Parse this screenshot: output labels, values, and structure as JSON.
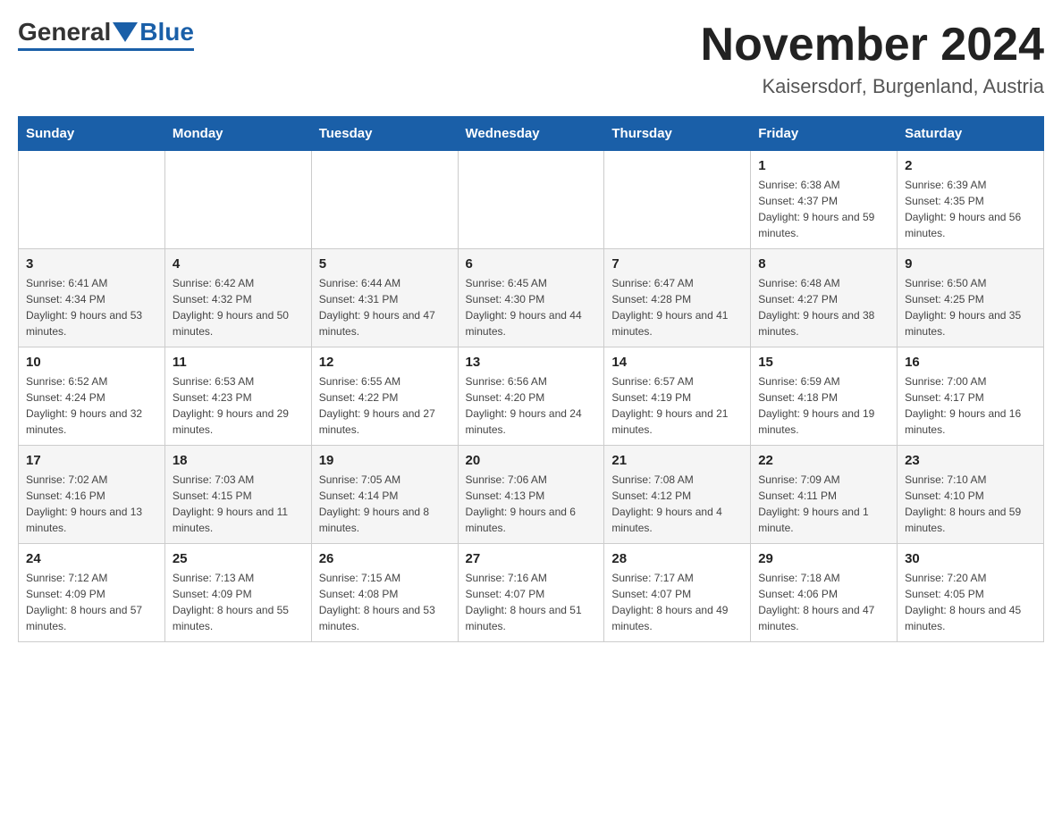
{
  "header": {
    "logo_general": "General",
    "logo_blue": "Blue",
    "month_title": "November 2024",
    "location": "Kaisersdorf, Burgenland, Austria"
  },
  "weekdays": [
    "Sunday",
    "Monday",
    "Tuesday",
    "Wednesday",
    "Thursday",
    "Friday",
    "Saturday"
  ],
  "weeks": [
    [
      {
        "day": "",
        "info": ""
      },
      {
        "day": "",
        "info": ""
      },
      {
        "day": "",
        "info": ""
      },
      {
        "day": "",
        "info": ""
      },
      {
        "day": "",
        "info": ""
      },
      {
        "day": "1",
        "info": "Sunrise: 6:38 AM\nSunset: 4:37 PM\nDaylight: 9 hours and 59 minutes."
      },
      {
        "day": "2",
        "info": "Sunrise: 6:39 AM\nSunset: 4:35 PM\nDaylight: 9 hours and 56 minutes."
      }
    ],
    [
      {
        "day": "3",
        "info": "Sunrise: 6:41 AM\nSunset: 4:34 PM\nDaylight: 9 hours and 53 minutes."
      },
      {
        "day": "4",
        "info": "Sunrise: 6:42 AM\nSunset: 4:32 PM\nDaylight: 9 hours and 50 minutes."
      },
      {
        "day": "5",
        "info": "Sunrise: 6:44 AM\nSunset: 4:31 PM\nDaylight: 9 hours and 47 minutes."
      },
      {
        "day": "6",
        "info": "Sunrise: 6:45 AM\nSunset: 4:30 PM\nDaylight: 9 hours and 44 minutes."
      },
      {
        "day": "7",
        "info": "Sunrise: 6:47 AM\nSunset: 4:28 PM\nDaylight: 9 hours and 41 minutes."
      },
      {
        "day": "8",
        "info": "Sunrise: 6:48 AM\nSunset: 4:27 PM\nDaylight: 9 hours and 38 minutes."
      },
      {
        "day": "9",
        "info": "Sunrise: 6:50 AM\nSunset: 4:25 PM\nDaylight: 9 hours and 35 minutes."
      }
    ],
    [
      {
        "day": "10",
        "info": "Sunrise: 6:52 AM\nSunset: 4:24 PM\nDaylight: 9 hours and 32 minutes."
      },
      {
        "day": "11",
        "info": "Sunrise: 6:53 AM\nSunset: 4:23 PM\nDaylight: 9 hours and 29 minutes."
      },
      {
        "day": "12",
        "info": "Sunrise: 6:55 AM\nSunset: 4:22 PM\nDaylight: 9 hours and 27 minutes."
      },
      {
        "day": "13",
        "info": "Sunrise: 6:56 AM\nSunset: 4:20 PM\nDaylight: 9 hours and 24 minutes."
      },
      {
        "day": "14",
        "info": "Sunrise: 6:57 AM\nSunset: 4:19 PM\nDaylight: 9 hours and 21 minutes."
      },
      {
        "day": "15",
        "info": "Sunrise: 6:59 AM\nSunset: 4:18 PM\nDaylight: 9 hours and 19 minutes."
      },
      {
        "day": "16",
        "info": "Sunrise: 7:00 AM\nSunset: 4:17 PM\nDaylight: 9 hours and 16 minutes."
      }
    ],
    [
      {
        "day": "17",
        "info": "Sunrise: 7:02 AM\nSunset: 4:16 PM\nDaylight: 9 hours and 13 minutes."
      },
      {
        "day": "18",
        "info": "Sunrise: 7:03 AM\nSunset: 4:15 PM\nDaylight: 9 hours and 11 minutes."
      },
      {
        "day": "19",
        "info": "Sunrise: 7:05 AM\nSunset: 4:14 PM\nDaylight: 9 hours and 8 minutes."
      },
      {
        "day": "20",
        "info": "Sunrise: 7:06 AM\nSunset: 4:13 PM\nDaylight: 9 hours and 6 minutes."
      },
      {
        "day": "21",
        "info": "Sunrise: 7:08 AM\nSunset: 4:12 PM\nDaylight: 9 hours and 4 minutes."
      },
      {
        "day": "22",
        "info": "Sunrise: 7:09 AM\nSunset: 4:11 PM\nDaylight: 9 hours and 1 minute."
      },
      {
        "day": "23",
        "info": "Sunrise: 7:10 AM\nSunset: 4:10 PM\nDaylight: 8 hours and 59 minutes."
      }
    ],
    [
      {
        "day": "24",
        "info": "Sunrise: 7:12 AM\nSunset: 4:09 PM\nDaylight: 8 hours and 57 minutes."
      },
      {
        "day": "25",
        "info": "Sunrise: 7:13 AM\nSunset: 4:09 PM\nDaylight: 8 hours and 55 minutes."
      },
      {
        "day": "26",
        "info": "Sunrise: 7:15 AM\nSunset: 4:08 PM\nDaylight: 8 hours and 53 minutes."
      },
      {
        "day": "27",
        "info": "Sunrise: 7:16 AM\nSunset: 4:07 PM\nDaylight: 8 hours and 51 minutes."
      },
      {
        "day": "28",
        "info": "Sunrise: 7:17 AM\nSunset: 4:07 PM\nDaylight: 8 hours and 49 minutes."
      },
      {
        "day": "29",
        "info": "Sunrise: 7:18 AM\nSunset: 4:06 PM\nDaylight: 8 hours and 47 minutes."
      },
      {
        "day": "30",
        "info": "Sunrise: 7:20 AM\nSunset: 4:05 PM\nDaylight: 8 hours and 45 minutes."
      }
    ]
  ]
}
